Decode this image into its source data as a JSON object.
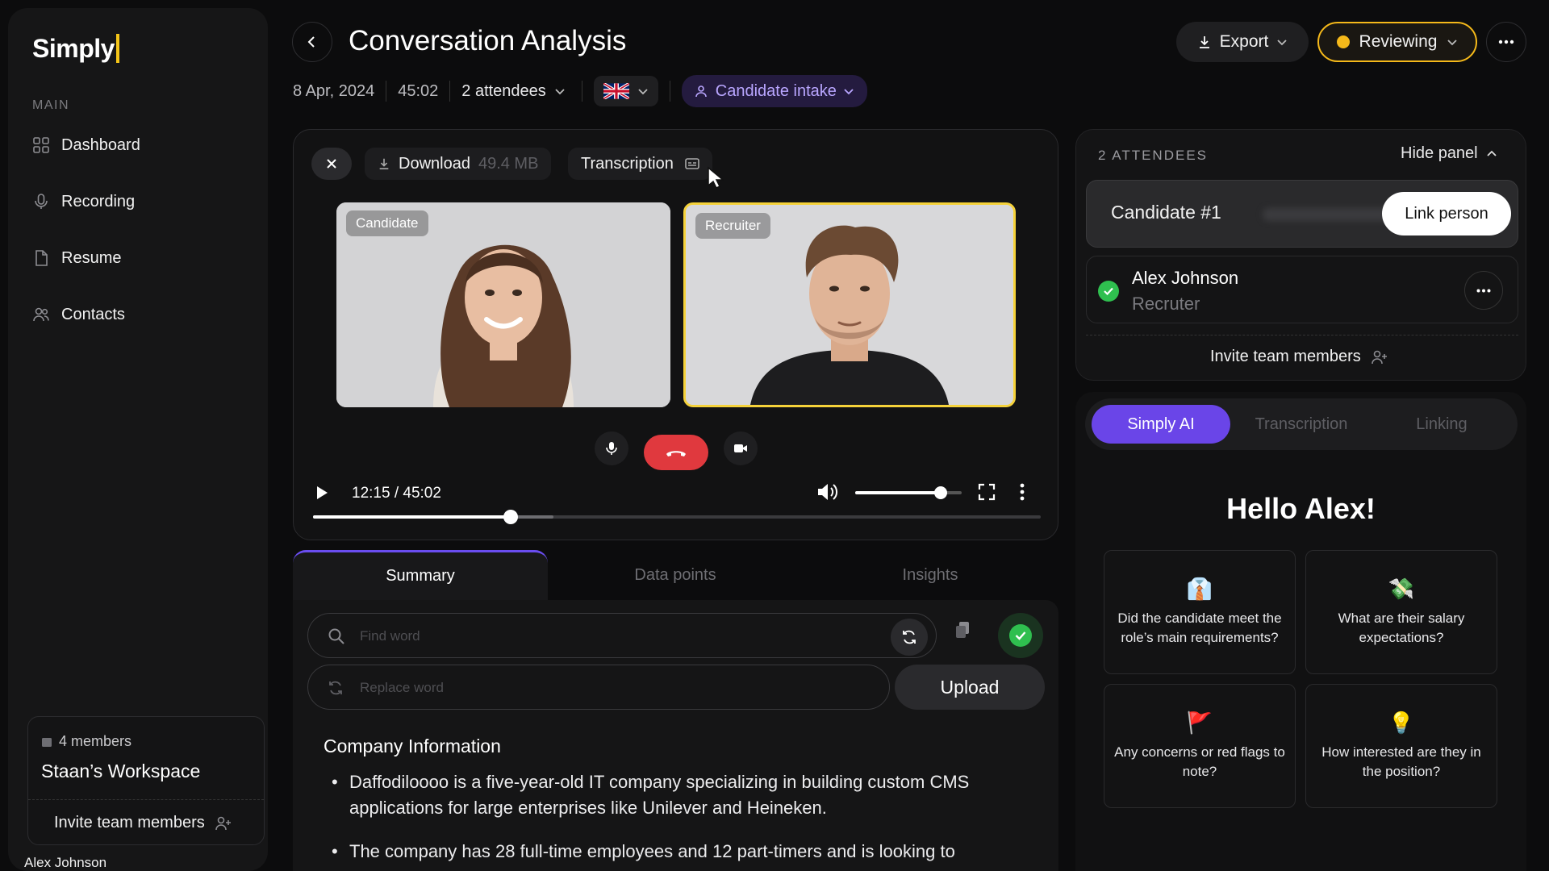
{
  "app": {
    "logo": "Simply",
    "accent": "#6a45e8",
    "highlight": "#f5b91a"
  },
  "sidebar": {
    "section_label": "MAIN",
    "items": [
      {
        "label": "Dashboard",
        "icon": "grid-icon"
      },
      {
        "label": "Recording",
        "icon": "mic-icon"
      },
      {
        "label": "Resume",
        "icon": "document-icon"
      },
      {
        "label": "Contacts",
        "icon": "people-icon"
      }
    ],
    "workspace": {
      "members": "4 members",
      "name": "Staan’s Workspace",
      "invite": "Invite team members"
    },
    "user_name": "Alex Johnson"
  },
  "header": {
    "title": "Conversation Analysis",
    "export_label": "Export",
    "status_label": "Reviewing",
    "date": "8 Apr, 2024",
    "duration": "45:02",
    "attendees": "2 attendees",
    "language_flag": "🇬🇧",
    "category": "Candidate intake"
  },
  "video": {
    "download_label": "Download",
    "download_size": "49.4 MB",
    "transcription_label": "Transcription",
    "tiles": [
      {
        "label": "Candidate"
      },
      {
        "label": "Recruiter"
      }
    ],
    "time": "12:15 / 45:02",
    "progress_fraction": 0.272,
    "buffer_fraction": 0.33,
    "volume_fraction": 0.8
  },
  "summary": {
    "tabs": [
      "Summary",
      "Data points",
      "Insights"
    ],
    "find_placeholder": "Find word",
    "replace_placeholder": "Replace word",
    "upload_label": "Upload",
    "heading": "Company Information",
    "bullets": [
      "Daffodiloooo is a five-year-old IT company specializing in building custom CMS applications for large enterprises like Unilever and Heineken.",
      "The company has 28 full-time employees and 12 part-timers and is looking to"
    ]
  },
  "attendees_panel": {
    "title": "2 ATTENDEES",
    "hide_label": "Hide panel",
    "candidate_label": "Candidate #1",
    "link_label": "Link person",
    "person_name": "Alex Johnson",
    "person_role": "Recruter",
    "invite": "Invite team members"
  },
  "ai_panel": {
    "tabs": [
      "Simply AI",
      "Transcription",
      "Linking"
    ],
    "greeting": "Hello Alex!",
    "prompts": [
      {
        "emoji": "👔",
        "text": "Did the candidate meet the role’s main requirements?"
      },
      {
        "emoji": "💸",
        "text": "What are their salary expectations?"
      },
      {
        "emoji": "🚩",
        "text": "Any concerns or red flags to note?"
      },
      {
        "emoji": "💡",
        "text": "How interested are they in the position?"
      }
    ]
  }
}
